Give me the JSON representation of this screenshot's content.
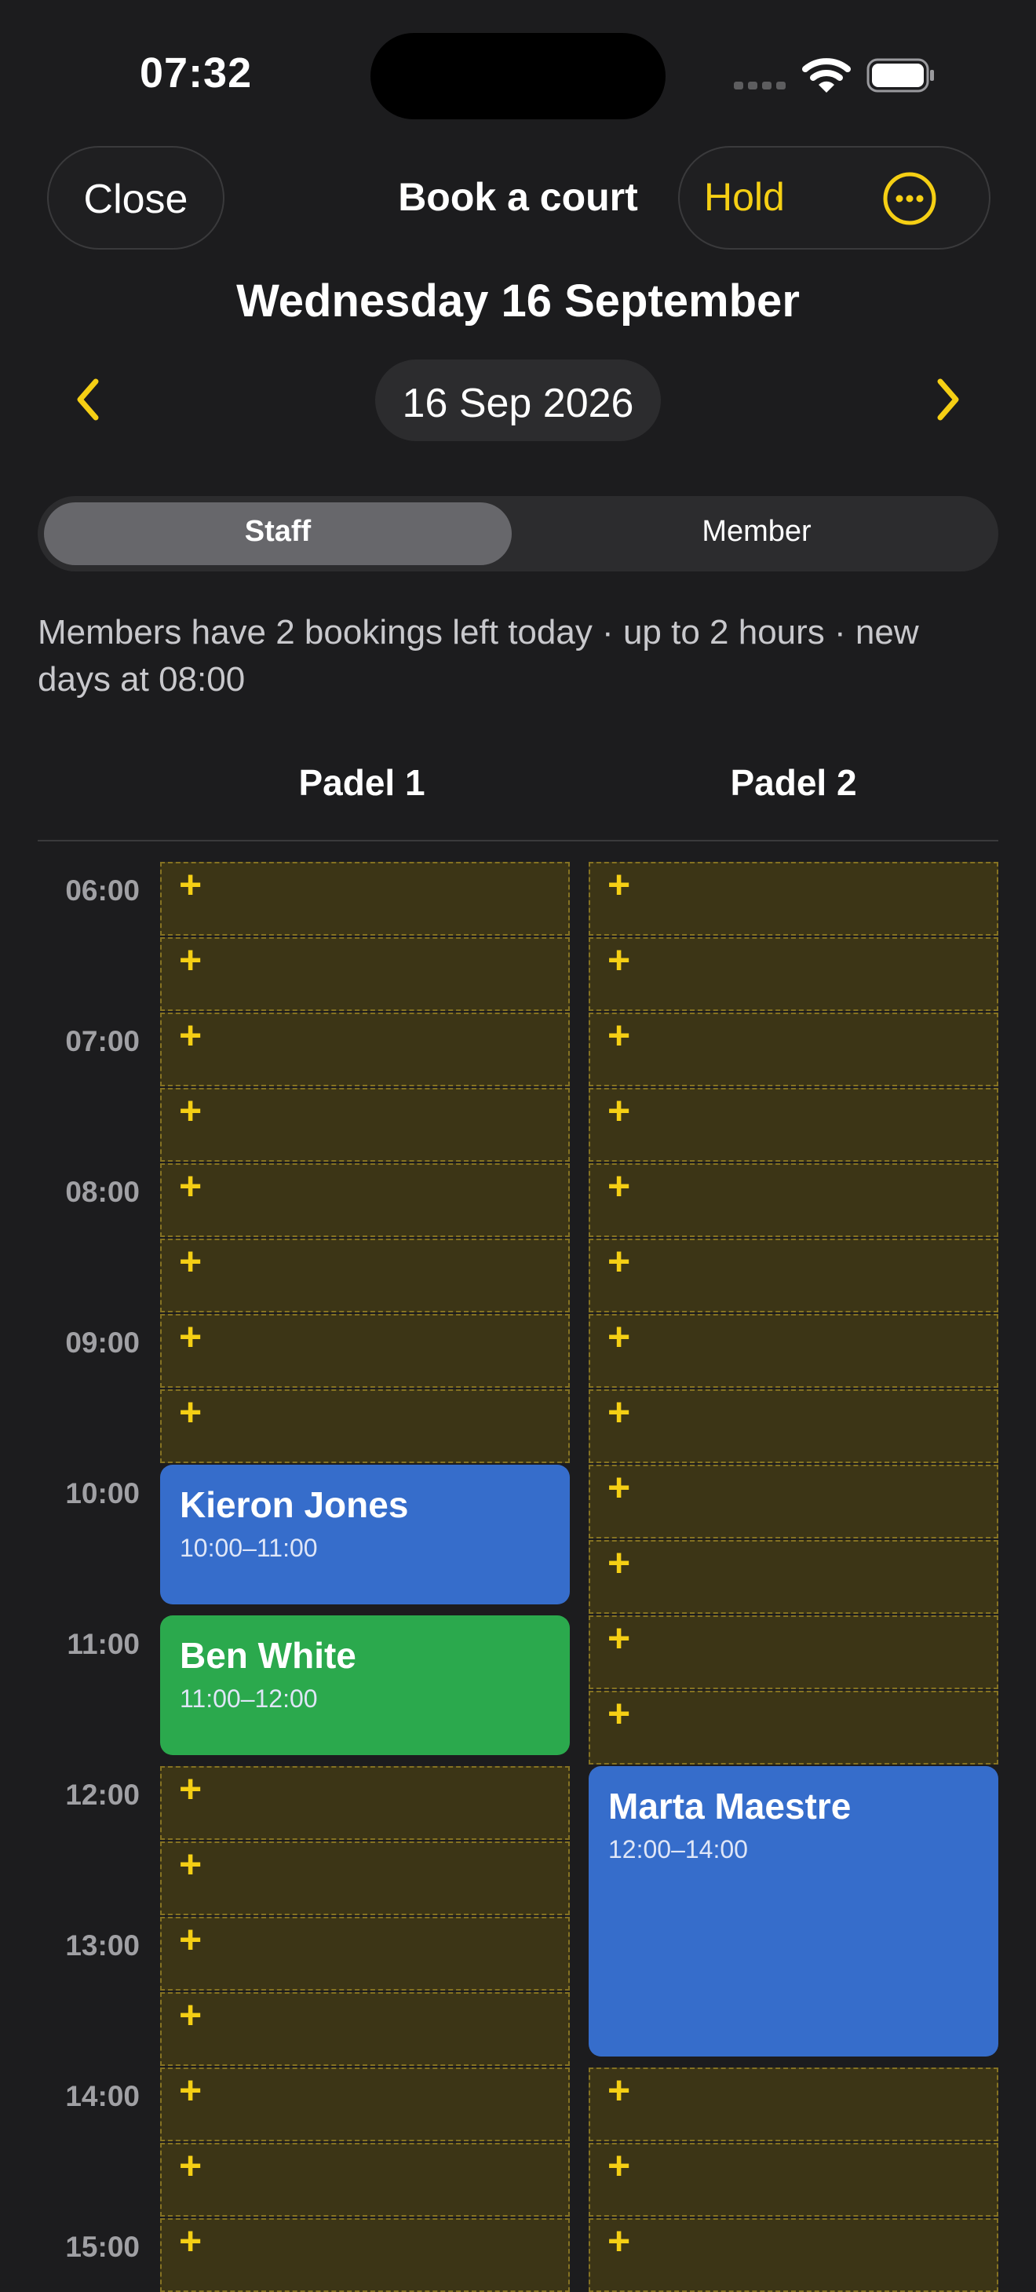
{
  "status_bar": {
    "time": "07:32"
  },
  "nav": {
    "close_label": "Close",
    "title": "Book a court",
    "hold_label": "Hold"
  },
  "date": {
    "heading": "Wednesday 16 September",
    "picker_value": "16 Sep 2026"
  },
  "segments": {
    "staff": "Staff",
    "member": "Member",
    "selected": "Staff"
  },
  "info_text": "Members have 2 bookings left today · up to 2 hours · new days at 08:00",
  "courts": [
    "Padel 1",
    "Padel 2"
  ],
  "hours": [
    "06:00",
    "07:00",
    "08:00",
    "09:00",
    "10:00",
    "11:00",
    "12:00",
    "13:00",
    "14:00",
    "15:00"
  ],
  "slot_icon": "+",
  "bookings": [
    {
      "court": "Padel 1",
      "name": "Kieron Jones",
      "range": "10:00–11:00",
      "color": "#366dcb"
    },
    {
      "court": "Padel 1",
      "name": "Ben White",
      "range": "11:00–12:00",
      "color": "#2ba94d"
    },
    {
      "court": "Padel 2",
      "name": "Marta Maestre",
      "range": "12:00–14:00",
      "color": "#366dcb"
    }
  ],
  "colors": {
    "accent": "#f5cf14",
    "background": "#1c1c1e",
    "slot_fill": "#3c3516"
  }
}
